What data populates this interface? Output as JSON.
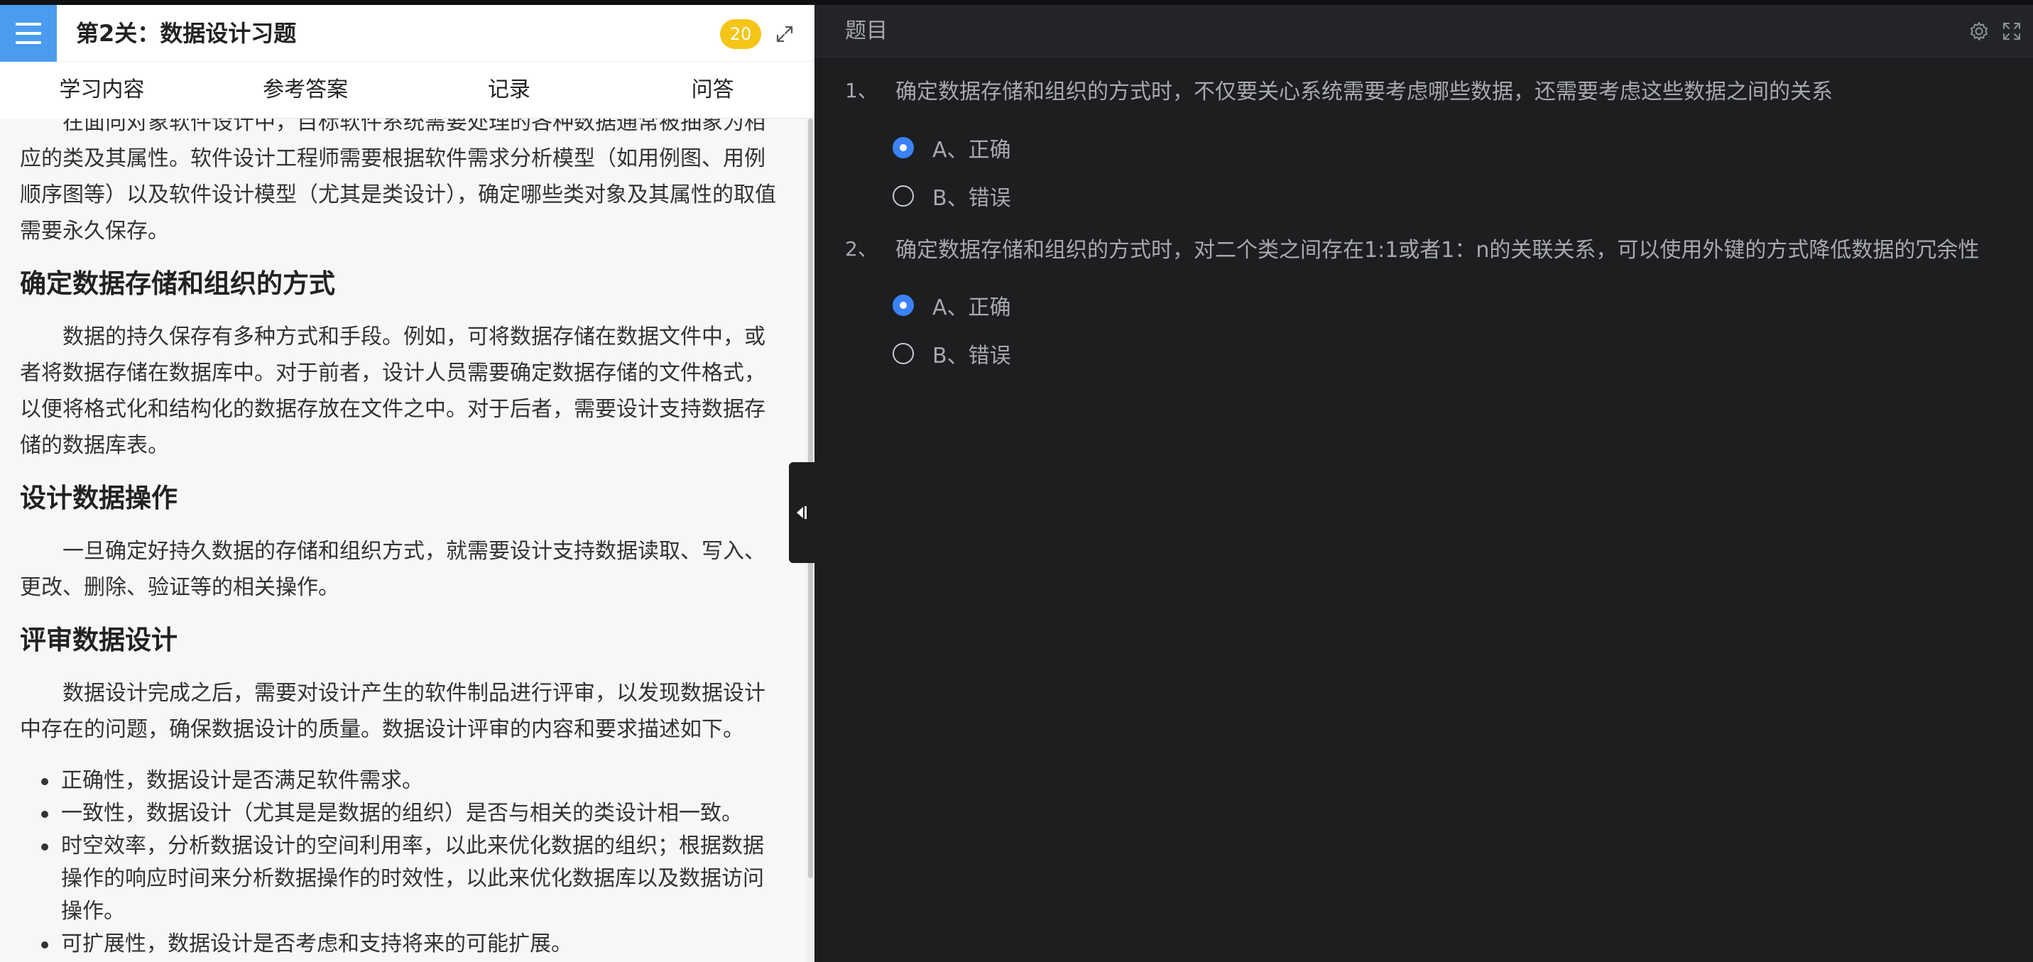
{
  "left_panel": {
    "stage_title": "第2关：数据设计习题",
    "badge_count": "20",
    "tabs": [
      {
        "label": "学习内容"
      },
      {
        "label": "参考答案"
      },
      {
        "label": "记录"
      },
      {
        "label": "问答"
      }
    ],
    "content": {
      "intro_para": "在面向对象软件设计中，目标软件系统需要处理的各种数据通常被抽象为相应的类及其属性。软件设计工程师需要根据软件需求分析模型（如用例图、用例顺序图等）以及软件设计模型（尤其是类设计），确定哪些类对象及其属性的取值需要永久保存。",
      "section1_heading": "确定数据存储和组织的方式",
      "section1_para": "数据的持久保存有多种方式和手段。例如，可将数据存储在数据文件中，或者将数据存储在数据库中。对于前者，设计人员需要确定数据存储的文件格式，以便将格式化和结构化的数据存放在文件之中。对于后者，需要设计支持数据存储的数据库表。",
      "section2_heading": "设计数据操作",
      "section2_para": "一旦确定好持久数据的存储和组织方式，就需要设计支持数据读取、写入、更改、删除、验证等的相关操作。",
      "section3_heading": "评审数据设计",
      "section3_para": "数据设计完成之后，需要对设计产生的软件制品进行评审，以发现数据设计中存在的问题，确保数据设计的质量。数据设计评审的内容和要求描述如下。",
      "bullets": [
        "正确性，数据设计是否满足软件需求。",
        "一致性，数据设计（尤其是是数据的组织）是否与相关的类设计相一致。",
        "时空效率，分析数据设计的空间利用率，以此来优化数据的组织；根据数据操作的响应时间来分析数据操作的时效性，以此来优化数据库以及数据访问操作。",
        "可扩展性，数据设计是否考虑和支持将来的可能扩展。"
      ]
    }
  },
  "right_panel": {
    "title": "题目",
    "questions": [
      {
        "number": "1、",
        "text": "确定数据存储和组织的方式时，不仅要关心系统需要考虑哪些数据，还需要考虑这些数据之间的关系",
        "options": [
          {
            "label": "A、正确",
            "selected": true
          },
          {
            "label": "B、错误",
            "selected": false
          }
        ]
      },
      {
        "number": "2、",
        "text": "确定数据存储和组织的方式时，对二个类之间存在1:1或者1：n的关联关系，可以使用外键的方式降低数据的冗余性",
        "options": [
          {
            "label": "A、正确",
            "selected": true
          },
          {
            "label": "B、错误",
            "selected": false
          }
        ]
      }
    ]
  },
  "colors": {
    "accent_blue": "#4b9cf0",
    "radio_selected": "#3b82f6",
    "badge_yellow": "#f5c518",
    "dark_bg": "#1d1e20"
  },
  "icons": [
    "menu-icon",
    "expand-icon",
    "collapse-panel-icon",
    "gear-icon",
    "fullscreen-icon"
  ]
}
